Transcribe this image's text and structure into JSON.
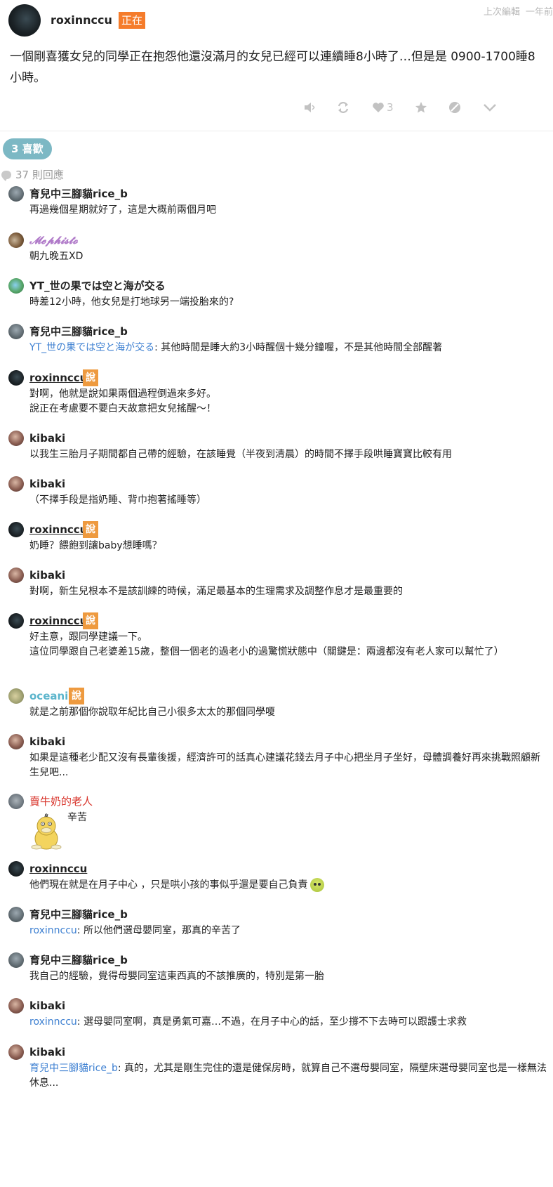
{
  "post": {
    "author": "roxinnccu",
    "status_badge": "正在",
    "edit_label": "上次編輯",
    "edit_time": "一年前",
    "body": "一個剛喜獲女兒的同學正在抱怨他還沒滿月的女兒已經可以連續睡8小時了…但是是 0900-1700睡8小時。",
    "like_count": "3",
    "actions": [
      "speaker-icon",
      "repost-icon",
      "heart-icon",
      "star-icon",
      "block-icon",
      "chevron-down-icon"
    ]
  },
  "likes_label": "3 喜歡",
  "reply_count_label": "37 則回應",
  "say_label": "說",
  "comments": [
    {
      "author": "育兒中三腳貓rice_b",
      "lines": [
        "再過幾個星期就好了，這是大概前兩個月吧"
      ]
    },
    {
      "author": "𝓜𝓮𝓹𝓱𝓲𝓼𝓽𝓸",
      "lines": [
        "朝九晚五XD"
      ]
    },
    {
      "author": "YT_世の果では空と海が交る",
      "lines": [
        "時差12小時，他女兒是打地球另一端投胎來的?"
      ]
    },
    {
      "author": "育兒中三腳貓rice_b",
      "mention": "YT_世の果では空と海が交る",
      "lines": [
        ": 其他時間是睡大約3小時醒個十幾分鐘喔，不是其他時間全部醒著"
      ]
    },
    {
      "author": "roxinnccu",
      "lines": [
        "對啊，他就是說如果兩個過程倒過來多好。",
        "說正在考慮要不要白天故意把女兒搖醒～！"
      ]
    },
    {
      "author": "kibaki",
      "lines": [
        "以我生三胎月子期間都自己帶的經驗，在該睡覺（半夜到清晨）的時間不擇手段哄睡寶寶比較有用"
      ]
    },
    {
      "author": "kibaki",
      "lines": [
        "（不擇手段是指奶睡、背巾抱著搖睡等）"
      ]
    },
    {
      "author": "roxinnccu",
      "lines": [
        "奶睡？餵飽到讓baby想睡嗎？"
      ]
    },
    {
      "author": "kibaki",
      "lines": [
        "對啊，新生兒根本不是該訓練的時候，滿足最基本的生理需求及調整作息才是最重要的"
      ]
    },
    {
      "author": "roxinnccu",
      "lines": [
        "好主意，跟同學建議一下。",
        "這位同學跟自己老婆差15歲，整個一個老的過老小的過驚慌狀態中（關鍵是：兩邊都沒有老人家可以幫忙了）"
      ]
    },
    {
      "author": "oceanic",
      "lines": [
        "就是之前那個你說取年紀比自己小很多太太的那個同學嗄"
      ]
    },
    {
      "author": "kibaki",
      "lines": [
        "如果是這種老少配又沒有長輩後援，經濟許可的話真心建議花錢去月子中心把坐月子坐好，母體調養好再來挑戰照顧新生兒吧..."
      ]
    },
    {
      "author": "賣牛奶的老人",
      "lines": [
        "辛苦"
      ]
    },
    {
      "author": "roxinnccu",
      "lines": [
        "他們現在就是在月子中心 ，只是哄小孩的事似乎還是要自己負責"
      ]
    },
    {
      "author": "育兒中三腳貓rice_b",
      "mention": "roxinnccu",
      "lines": [
        ": 所以他們選母嬰同室，那真的辛苦了"
      ]
    },
    {
      "author": "育兒中三腳貓rice_b",
      "lines": [
        "我自己的經驗，覺得母嬰同室這東西真的不該推廣的，特別是第一胎"
      ]
    },
    {
      "author": "kibaki",
      "mention": "roxinnccu",
      "lines": [
        ": 選母嬰同室啊，真是勇氣可嘉…不過，在月子中心的話，至少撐不下去時可以跟護士求救"
      ]
    },
    {
      "author": "kibaki",
      "mention": "育兒中三腳貓rice_b",
      "lines": [
        ": 真的，尤其是剛生完住的還是健保房時，就算自己不選母嬰同室，隔壁床選母嬰同室也是一樣無法休息..."
      ]
    }
  ]
}
